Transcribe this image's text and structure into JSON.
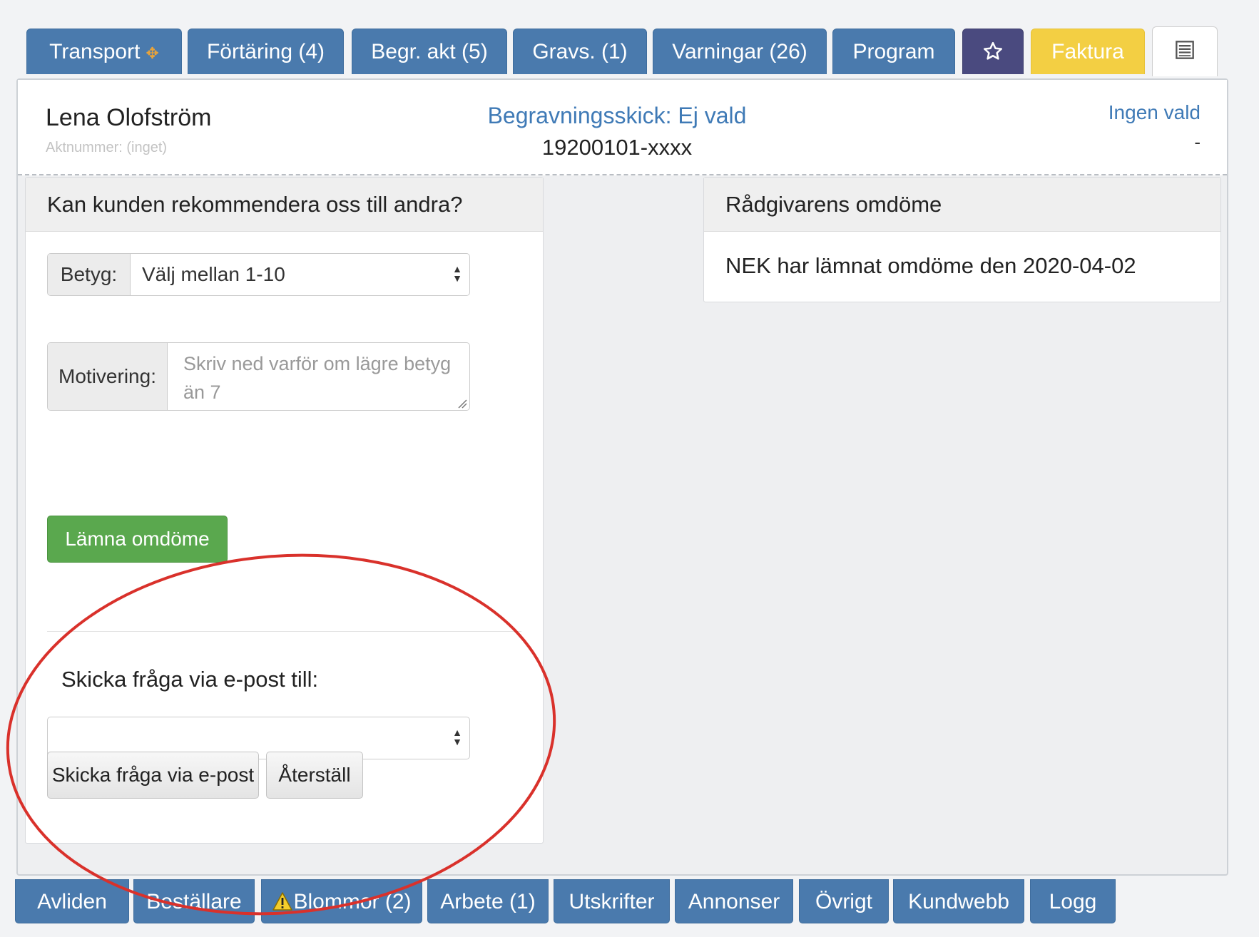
{
  "top_tabs": [
    {
      "label": "Transport",
      "icon": "move-icon"
    },
    {
      "label": "Förtäring (4)"
    },
    {
      "label": "Begr. akt (5)"
    },
    {
      "label": "Gravs. (1)"
    },
    {
      "label": "Varningar (26)"
    },
    {
      "label": "Program"
    },
    {
      "label": "",
      "icon": "star-icon"
    },
    {
      "label": "Faktura"
    },
    {
      "label": "",
      "icon": "list-icon"
    }
  ],
  "header": {
    "name": "Lena Olofström",
    "aktnummer": "Aktnummer: (inget)",
    "begravningsskick": "Begravningsskick: Ej vald",
    "personnummer": "19200101-xxxx",
    "ingen_vald": "Ingen vald",
    "dash": "-"
  },
  "recommend_card": {
    "title": "Kan kunden rekommendera oss till andra?",
    "betyg_label": "Betyg:",
    "betyg_value": "Välj mellan 1-10",
    "motivering_label": "Motivering:",
    "motivering_placeholder": "Skriv ned varför om lägre betyg än 7",
    "submit_label": "Lämna omdöme",
    "send_label": "Skicka fråga via e-post till:",
    "send_value": "",
    "send_button": "Skicka fråga via e-post",
    "reset_button": "Återställ"
  },
  "advisor_card": {
    "title": "Rådgivarens omdöme",
    "text": "NEK har lämnat omdöme den 2020-04-02"
  },
  "bottom_tabs": [
    {
      "label": "Avliden"
    },
    {
      "label": "Beställare"
    },
    {
      "label": "Blommor (2)",
      "icon": "warning-icon"
    },
    {
      "label": "Arbete (1)"
    },
    {
      "label": "Utskrifter"
    },
    {
      "label": "Annonser"
    },
    {
      "label": "Övrigt"
    },
    {
      "label": "Kundwebb"
    },
    {
      "label": "Logg"
    }
  ],
  "colors": {
    "tab_blue": "#4a7aad",
    "star_tab": "#4a4a7f",
    "faktura_tab": "#f3cf43",
    "link_blue": "#3f7ab6",
    "green_button": "#5aa84e",
    "annotation_red": "#d9312b"
  }
}
